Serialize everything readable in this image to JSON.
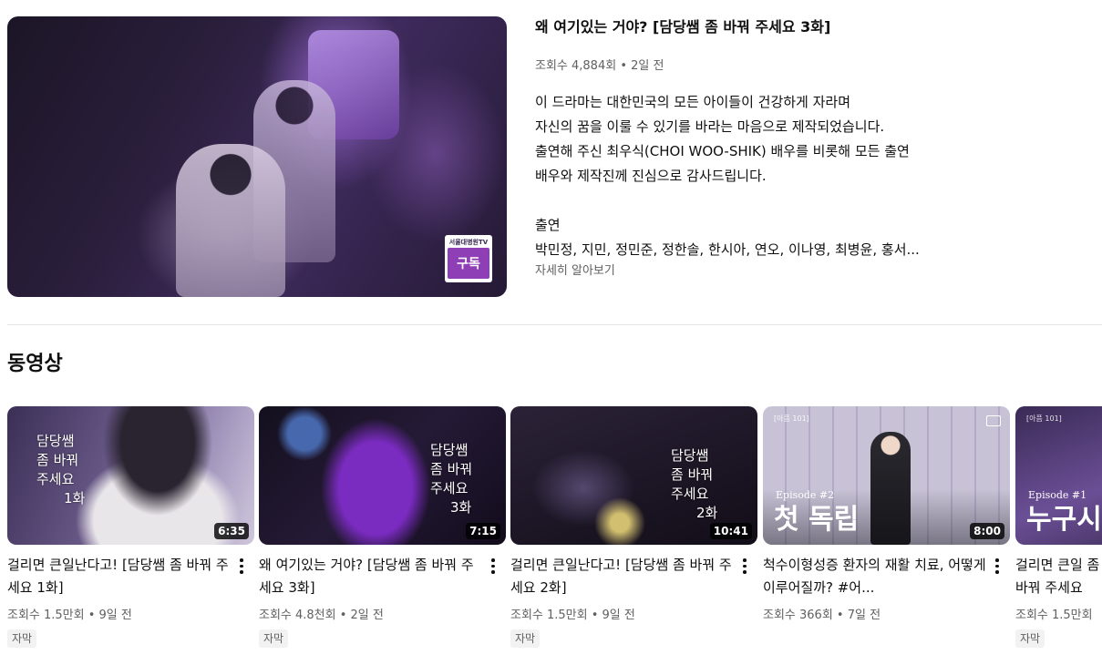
{
  "featured": {
    "title": "왜 여기있는 거야? [담당쌤 좀 바꿔 주세요 3화]",
    "meta": "조회수 4,884회 • 2일 전",
    "description": [
      "이 드라마는 대한민국의 모든 아이들이 건강하게 자라며",
      "자신의 꿈을 이룰 수 있기를 바라는 마음으로 제작되었습니다.",
      "출연해 주신 최우식(CHOI WOO-SHIK) 배우를 비롯해 모든 출연",
      "배우와 제작진께 진심으로 감사드립니다."
    ],
    "cast_heading": "출연",
    "cast": "박민정, 지민, 정민준, 정한솔, 한시아, 연오, 이나영, 최병윤, 홍서...",
    "more": "자세히 알아보기",
    "badge_top": "서울대병원TV",
    "badge_button": "구독"
  },
  "section": {
    "title": "동영상"
  },
  "videos": [
    {
      "title": "걸리면 큰일난다고! [담당쌤 좀 바꿔 주세요 1화]",
      "meta": "조회수 1.5만회 • 9일 전",
      "badge": "자막",
      "duration": "6:35",
      "overlay": [
        "담당쌤",
        "좀 바꿔",
        "주세요",
        "1화"
      ]
    },
    {
      "title": "왜 여기있는 거야? [담당쌤 좀 바꿔 주세요 3화]",
      "meta": "조회수 4.8천회 • 2일 전",
      "badge": "자막",
      "duration": "7:15",
      "overlay": [
        "담당쌤",
        "좀 바꿔",
        "주세요",
        "3화"
      ]
    },
    {
      "title": "걸리면 큰일난다고! [담당쌤 좀 바꿔 주세요 2화]",
      "meta": "조회수 1.5만회 • 9일 전",
      "badge": "자막",
      "duration": "10:41",
      "overlay": [
        "담당쌤",
        "좀 바꿔",
        "주세요",
        "2화"
      ]
    },
    {
      "title": "척수이형성증 환자의 재활 치료, 어떻게 이루어질까? #어...",
      "meta": "조회수 366회 • 7일 전",
      "badge": "",
      "duration": "8:00",
      "episode": "Episode #2",
      "big_title": "첫 독립",
      "corner_tag": "[아픔 101]"
    },
    {
      "title": "걸리면 큰일 좀 바꿔 주세요",
      "meta": "조회수 1.5만회",
      "badge": "자막",
      "episode": "Episode #1",
      "big_title": "누구시",
      "corner_tag": "[아픔 101]"
    }
  ]
}
